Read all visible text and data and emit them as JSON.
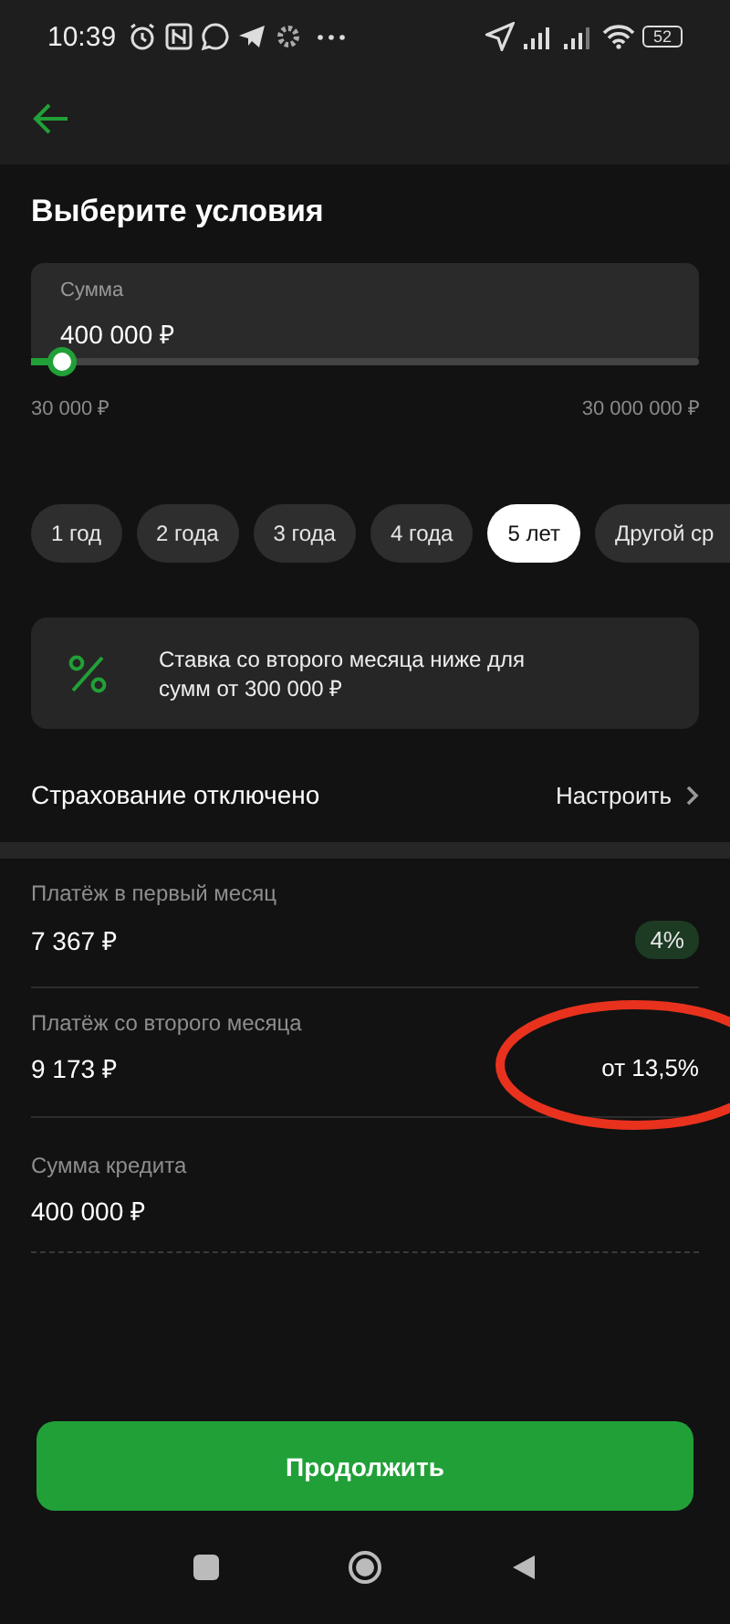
{
  "status_bar": {
    "time": "10:39",
    "battery": "52"
  },
  "title": "Выберите условия",
  "amount": {
    "label": "Сумма",
    "value": "400 000 ₽",
    "level": 0.03,
    "min": "30 000 ₽",
    "max": "30 000 000 ₽"
  },
  "terms": [
    {
      "label": "1 год",
      "selected": false
    },
    {
      "label": "2 года",
      "selected": false
    },
    {
      "label": "3 года",
      "selected": false
    },
    {
      "label": "4 года",
      "selected": false
    },
    {
      "label": "5 лет",
      "selected": true
    },
    {
      "label": "Другой ср",
      "selected": false
    }
  ],
  "notice": {
    "text": "Ставка со второго месяца ниже для сумм от 300 000 ₽"
  },
  "insurance": {
    "label": "Страхование отключено",
    "action": "Настроить"
  },
  "details": [
    {
      "label": "Платёж в первый месяц",
      "value": "7 367 ₽",
      "rate": "4%",
      "kind": "badge",
      "circled": false
    },
    {
      "label": "Платёж со второго месяца",
      "value": "9 173 ₽",
      "rate": "от 13,5%",
      "kind": "plain",
      "circled": true
    },
    {
      "label": "Сумма кредита",
      "value": "400 000 ₽",
      "kind": "none",
      "circled": false
    }
  ],
  "continue_button": "Продолжить"
}
